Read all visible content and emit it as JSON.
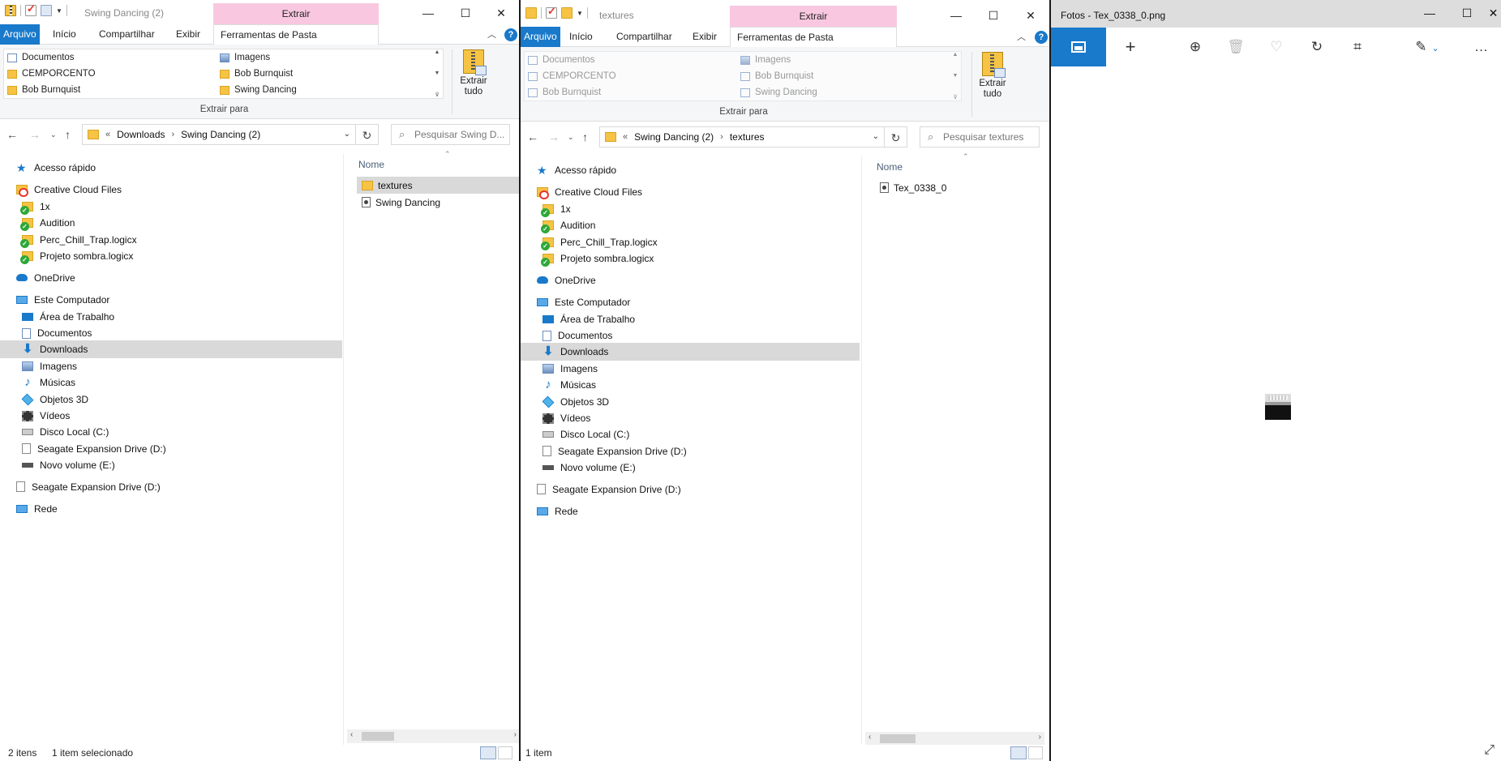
{
  "left_window": {
    "title": "Swing Dancing (2)",
    "context_tab": "Extrair",
    "tabs": [
      "Arquivo",
      "Início",
      "Compartilhar",
      "Exibir",
      "Ferramentas de Pasta Compactada"
    ],
    "gallery": {
      "col1": [
        "Documentos",
        "CEMPORCENTO",
        "Bob Burnquist"
      ],
      "col2": [
        "Imagens",
        "Bob Burnquist",
        "Swing Dancing"
      ]
    },
    "extract_to_label": "Extrair para",
    "extract_all_label": "Extrair tudo",
    "address": {
      "prefix": "«",
      "crumbs": [
        "Downloads",
        "Swing Dancing (2)"
      ]
    },
    "search_placeholder": "Pesquisar Swing D...",
    "column_name": "Nome",
    "files": [
      {
        "name": "textures",
        "type": "folder",
        "selected": true
      },
      {
        "name": "Swing Dancing",
        "type": "file",
        "selected": false
      }
    ],
    "status_items": "2 itens",
    "status_selected": "1 item selecionado"
  },
  "right_window": {
    "title": "textures",
    "context_tab": "Extrair",
    "tabs": [
      "Arquivo",
      "Início",
      "Compartilhar",
      "Exibir",
      "Ferramentas de Pasta Compactada"
    ],
    "gallery": {
      "col1": [
        "Documentos",
        "CEMPORCENTO",
        "Bob Burnquist"
      ],
      "col2": [
        "Imagens",
        "Bob Burnquist",
        "Swing Dancing"
      ]
    },
    "extract_to_label": "Extrair para",
    "extract_all_label": "Extrair tudo",
    "address": {
      "prefix": "«",
      "crumbs": [
        "Swing Dancing (2)",
        "textures"
      ]
    },
    "search_placeholder": "Pesquisar textures",
    "column_name": "Nome",
    "files": [
      {
        "name": "Tex_0338_0",
        "type": "file",
        "selected": false
      }
    ],
    "status_items": "1 item"
  },
  "nav_tree": [
    {
      "label": "Acesso rápido",
      "icon": "star-icon",
      "level": 0
    },
    {
      "label": "Creative Cloud Files",
      "icon": "creative-cloud-folder-icon",
      "level": 0
    },
    {
      "label": "1x",
      "icon": "synced-folder-icon",
      "level": 1
    },
    {
      "label": "Audition",
      "icon": "synced-folder-icon",
      "level": 1
    },
    {
      "label": "Perc_Chill_Trap.logicx",
      "icon": "synced-folder-icon",
      "level": 1
    },
    {
      "label": "Projeto sombra.logicx",
      "icon": "synced-folder-icon",
      "level": 1
    },
    {
      "label": "OneDrive",
      "icon": "cloud-icon",
      "level": 0
    },
    {
      "label": "Este Computador",
      "icon": "computer-icon",
      "level": 0
    },
    {
      "label": "Área de Trabalho",
      "icon": "desktop-icon",
      "level": 1
    },
    {
      "label": "Documentos",
      "icon": "documents-icon",
      "level": 1
    },
    {
      "label": "Downloads",
      "icon": "downloads-icon",
      "level": 1,
      "selected": true
    },
    {
      "label": "Imagens",
      "icon": "pictures-icon",
      "level": 1
    },
    {
      "label": "Músicas",
      "icon": "music-icon",
      "level": 1
    },
    {
      "label": "Objetos 3D",
      "icon": "objects-3d-icon",
      "level": 1
    },
    {
      "label": "Vídeos",
      "icon": "videos-icon",
      "level": 1
    },
    {
      "label": "Disco Local (C:)",
      "icon": "local-disk-icon",
      "level": 1
    },
    {
      "label": "Seagate Expansion Drive (D:)",
      "icon": "drive-icon",
      "level": 1
    },
    {
      "label": "Novo volume (E:)",
      "icon": "volume-icon",
      "level": 1
    },
    {
      "label": "Seagate Expansion Drive (D:)",
      "icon": "drive-icon",
      "level": 0
    },
    {
      "label": "Rede",
      "icon": "network-icon",
      "level": 0
    }
  ],
  "photos_window": {
    "title": "Fotos - Tex_0338_0.png",
    "toolbar": [
      "home-icon",
      "add-icon",
      "zoom-in-icon",
      "delete-icon",
      "favorite-icon",
      "rotate-icon",
      "crop-icon",
      "edit-icon",
      "more-icon"
    ]
  },
  "colors": {
    "accent": "#1979ca",
    "context_tab": "#f9c8e0",
    "folder": "#f6c344",
    "selection": "#d9d9d9"
  }
}
